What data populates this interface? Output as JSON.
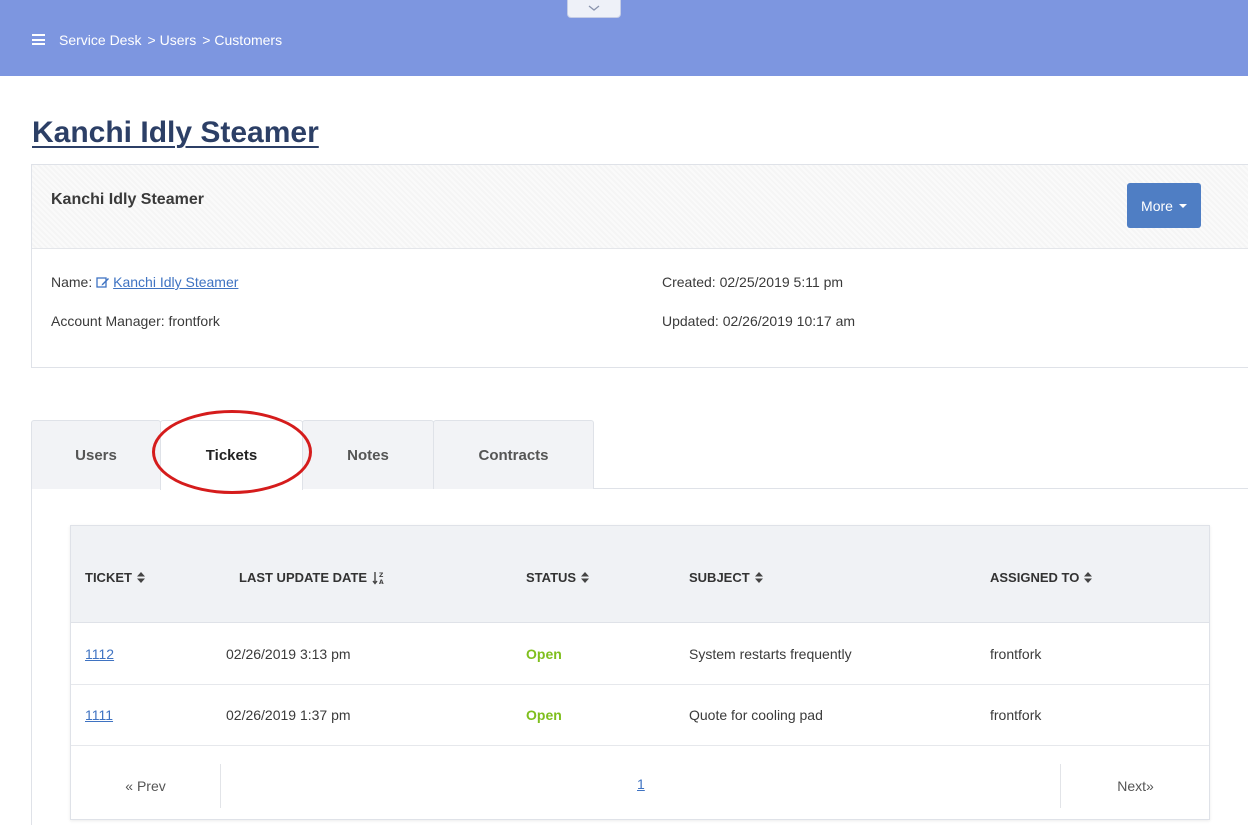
{
  "header": {
    "breadcrumb": [
      "Service Desk",
      "Users",
      "Customers"
    ],
    "breadcrumb_sep": ">",
    "bg_color": "#7d96e0"
  },
  "page": {
    "title": "Kanchi Idly Steamer"
  },
  "card": {
    "title": "Kanchi Idly Steamer",
    "more_label": "More",
    "name_label": "Name:",
    "name_value": "Kanchi Idly Steamer",
    "manager_label": "Account Manager: frontfork",
    "created_label": "Created: 02/25/2019 5:11 pm",
    "updated_label": "Updated: 02/26/2019 10:17 am"
  },
  "tabs": [
    {
      "label": "Users",
      "active": false
    },
    {
      "label": "Tickets",
      "active": true
    },
    {
      "label": "Notes",
      "active": false
    },
    {
      "label": "Contracts",
      "active": false
    }
  ],
  "table": {
    "columns": [
      "TICKET",
      "LAST UPDATE DATE",
      "STATUS",
      "SUBJECT",
      "ASSIGNED TO"
    ],
    "rows": [
      {
        "ticket": "1112",
        "date": "02/26/2019 3:13 pm",
        "status": "Open",
        "subject": "System restarts frequently",
        "assigned": "frontfork"
      },
      {
        "ticket": "1111",
        "date": "02/26/2019 1:37 pm",
        "status": "Open",
        "subject": "Quote for cooling pad",
        "assigned": "frontfork"
      }
    ]
  },
  "pager": {
    "prev": "« Prev",
    "page": "1",
    "next": "Next»"
  },
  "colors": {
    "accent": "#4f7ec4",
    "link": "#3f73c2",
    "status_open": "#7fbf1d",
    "highlight": "#d51c1c"
  }
}
